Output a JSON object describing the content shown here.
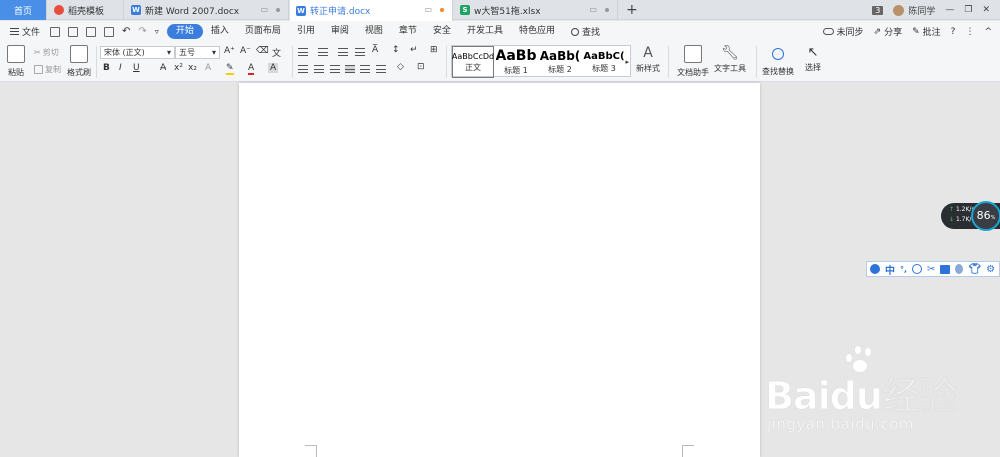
{
  "tabs": {
    "home": "首页",
    "docer": "稻壳模板",
    "new_doc": "新建 Word 2007.docx",
    "active_doc": "转正申请.docx",
    "xlsx": "w大智51拖.xlsx"
  },
  "window": {
    "count": "3",
    "user": "陈同学"
  },
  "menu": {
    "file": "文件",
    "items": [
      "开始",
      "插入",
      "页面布局",
      "引用",
      "审阅",
      "视图",
      "章节",
      "安全",
      "开发工具",
      "特色应用"
    ],
    "search": "查找",
    "sync": "未同步",
    "share": "分享",
    "comment": "批注"
  },
  "ribbon": {
    "paste": "粘贴",
    "cut": "剪切",
    "copy": "复制",
    "format_painter": "格式刷",
    "font_name": "宋体 (正文)",
    "font_size": "五号",
    "bold": "B",
    "italic": "I",
    "underline": "U",
    "styles": [
      {
        "sample": "AaBbCcDd",
        "label": "正文"
      },
      {
        "sample": "AaBb",
        "label": "标题 1"
      },
      {
        "sample": "AaBb(",
        "label": "标题 2"
      },
      {
        "sample": "AaBbC(",
        "label": "标题 3"
      }
    ],
    "new_style": "新样式",
    "doc_assistant": "文档助手",
    "text_tools": "文字工具",
    "find_replace": "查找替换",
    "select": "选择"
  },
  "speed": {
    "up": "1.2",
    "up_unit": "K/s",
    "down": "1.7",
    "down_unit": "K/s",
    "value": "86",
    "value_unit": "%"
  },
  "ime": {
    "mode": "中"
  },
  "watermark": {
    "main": "Baidu经验",
    "sub": "jingyan.baidu.com"
  }
}
